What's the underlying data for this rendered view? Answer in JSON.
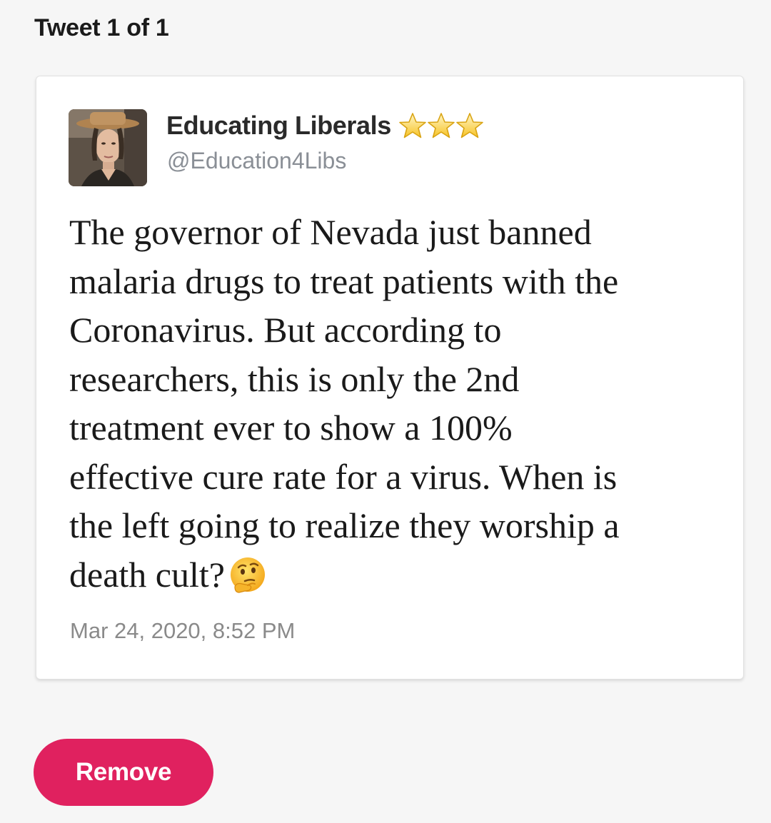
{
  "header": {
    "title": "Tweet 1 of 1"
  },
  "tweet": {
    "avatar_icon": "profile-photo",
    "author_name": "Educating Liberals",
    "badges": [
      "star-icon",
      "star-icon",
      "star-icon"
    ],
    "handle": "@Education4Libs",
    "text": "The governor of Nevada just banned\nmalaria drugs to treat patients with the\nCoronavirus. But according to\nresearchers, this is only the 2nd\ntreatment ever to show a 100%\neffective cure rate for a virus. When is\nthe left going to realize they worship a\ndeath cult?",
    "emoji": "thinking-face-icon",
    "timestamp": "Mar 24, 2020, 8:52 PM"
  },
  "actions": {
    "remove_label": "Remove"
  },
  "colors": {
    "accent": "#e0215f",
    "background": "#f6f6f6",
    "card": "#ffffff",
    "handle": "#8a8f96",
    "star": "#f7c325"
  }
}
